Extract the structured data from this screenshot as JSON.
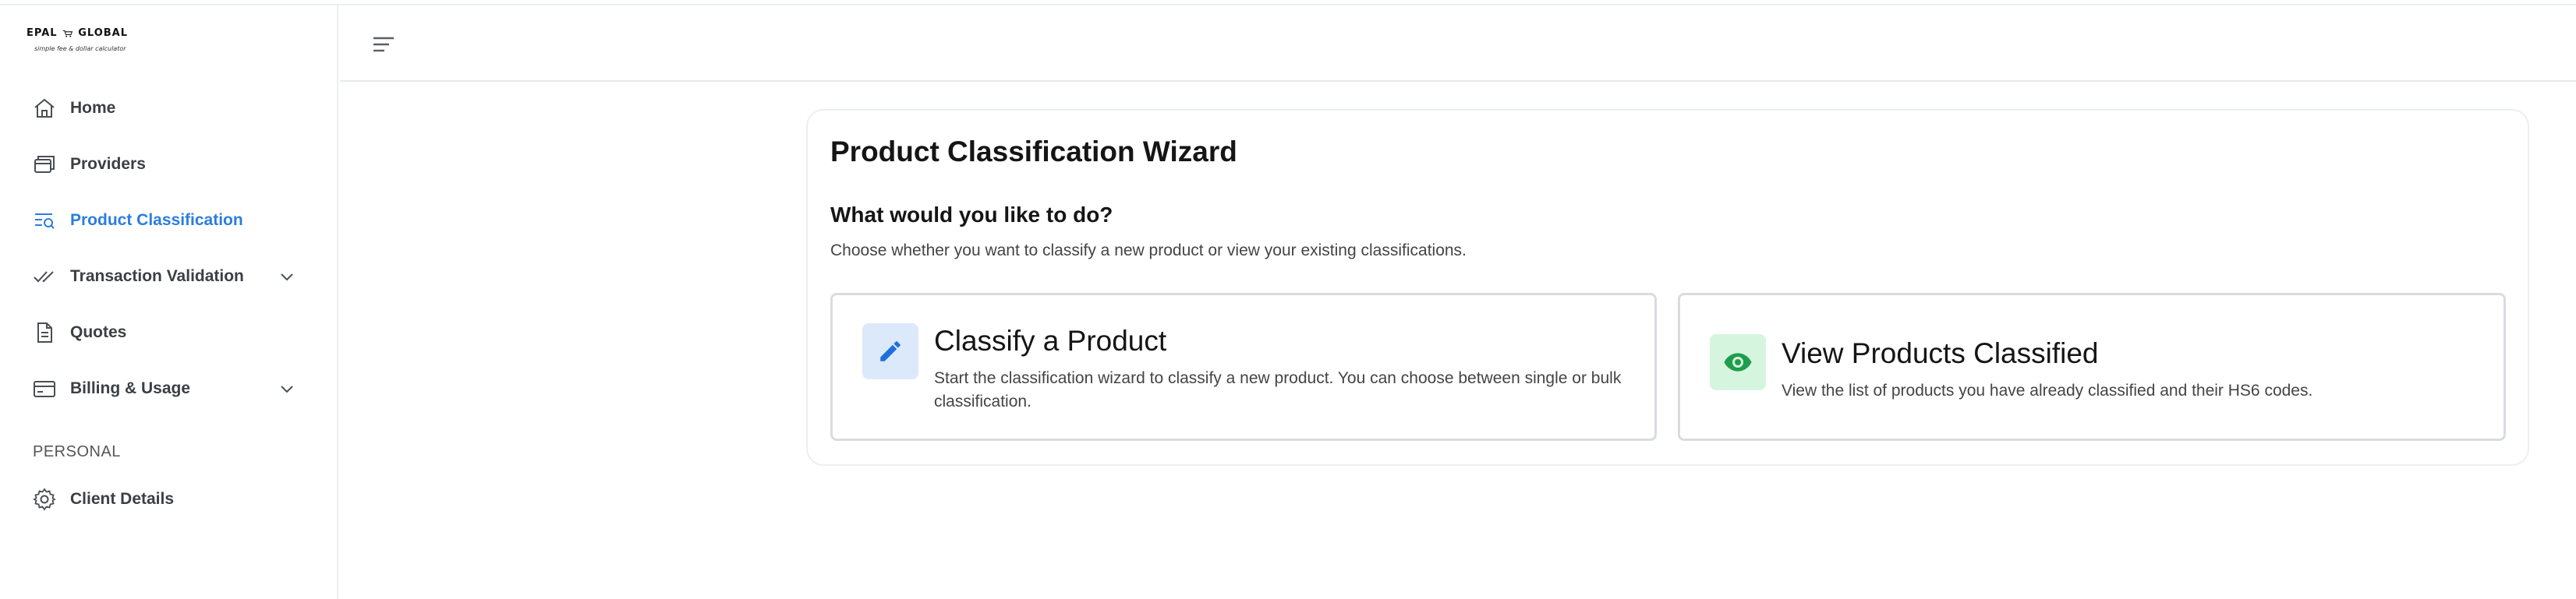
{
  "brand": {
    "name_left": "EPAL",
    "name_right": "GLOBAL",
    "tagline": "simple fee & dollar calculator"
  },
  "sidebar": {
    "items": [
      {
        "label": "Home",
        "icon": "home-icon"
      },
      {
        "label": "Providers",
        "icon": "cards-icon"
      },
      {
        "label": "Product Classification",
        "icon": "list-search-icon",
        "active": true
      },
      {
        "label": "Transaction Validation",
        "icon": "double-check-icon",
        "expandable": true
      },
      {
        "label": "Quotes",
        "icon": "document-icon"
      },
      {
        "label": "Billing & Usage",
        "icon": "credit-card-icon",
        "expandable": true
      }
    ],
    "section_label": "PERSONAL",
    "personal_items": [
      {
        "label": "Client Details",
        "icon": "gear-icon"
      }
    ]
  },
  "header": {
    "menu_icon": "menu-icon"
  },
  "main": {
    "title": "Product Classification Wizard",
    "question": "What would you like to do?",
    "description": "Choose whether you want to classify a new product or view your existing classifications.",
    "options": [
      {
        "title": "Classify a Product",
        "text": "Start the classification wizard to classify a new product. You can choose between single or bulk classification.",
        "icon": "pencil-icon"
      },
      {
        "title": "View Products Classified",
        "text": "View the list of products you have already classified and their HS6 codes.",
        "icon": "eye-icon"
      }
    ]
  },
  "colors": {
    "accent": "#2b7de0",
    "pencil_bg": "#dbe9fb",
    "eye_bg": "#d6f5df",
    "eye_color": "#1f9d4c"
  }
}
